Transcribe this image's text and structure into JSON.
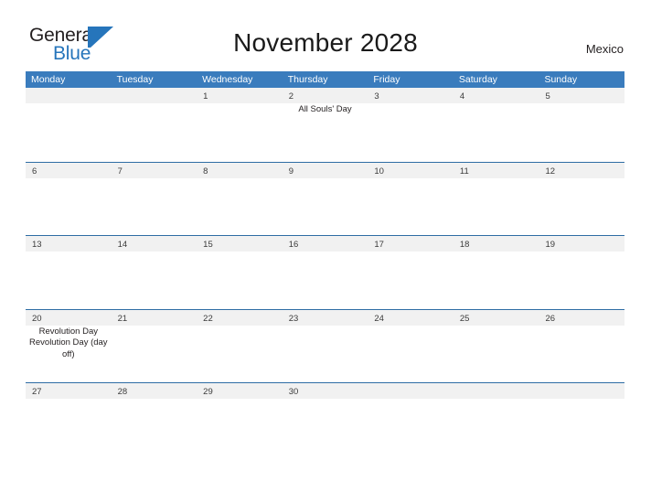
{
  "brand": {
    "name_top": "General",
    "name_bottom": "Blue",
    "mark": "triangle-logo-mark"
  },
  "header": {
    "title": "November 2028",
    "country": "Mexico"
  },
  "calendar": {
    "weekdays": [
      "Monday",
      "Tuesday",
      "Wednesday",
      "Thursday",
      "Friday",
      "Saturday",
      "Sunday"
    ],
    "colors": {
      "header_blue": "#3a7cbd",
      "divider_blue": "#2e6da4",
      "row_band": "#f1f1f1",
      "brand_blue": "#2675bb"
    },
    "weeks": [
      [
        {
          "date": "",
          "events": []
        },
        {
          "date": "",
          "events": []
        },
        {
          "date": "1",
          "events": []
        },
        {
          "date": "2",
          "events": [
            "All Souls' Day"
          ]
        },
        {
          "date": "3",
          "events": []
        },
        {
          "date": "4",
          "events": []
        },
        {
          "date": "5",
          "events": []
        }
      ],
      [
        {
          "date": "6",
          "events": []
        },
        {
          "date": "7",
          "events": []
        },
        {
          "date": "8",
          "events": []
        },
        {
          "date": "9",
          "events": []
        },
        {
          "date": "10",
          "events": []
        },
        {
          "date": "11",
          "events": []
        },
        {
          "date": "12",
          "events": []
        }
      ],
      [
        {
          "date": "13",
          "events": []
        },
        {
          "date": "14",
          "events": []
        },
        {
          "date": "15",
          "events": []
        },
        {
          "date": "16",
          "events": []
        },
        {
          "date": "17",
          "events": []
        },
        {
          "date": "18",
          "events": []
        },
        {
          "date": "19",
          "events": []
        }
      ],
      [
        {
          "date": "20",
          "events": [
            "Revolution Day",
            "Revolution Day (day off)"
          ]
        },
        {
          "date": "21",
          "events": []
        },
        {
          "date": "22",
          "events": []
        },
        {
          "date": "23",
          "events": []
        },
        {
          "date": "24",
          "events": []
        },
        {
          "date": "25",
          "events": []
        },
        {
          "date": "26",
          "events": []
        }
      ],
      [
        {
          "date": "27",
          "events": []
        },
        {
          "date": "28",
          "events": []
        },
        {
          "date": "29",
          "events": []
        },
        {
          "date": "30",
          "events": []
        },
        {
          "date": "",
          "events": []
        },
        {
          "date": "",
          "events": []
        },
        {
          "date": "",
          "events": []
        }
      ]
    ]
  }
}
